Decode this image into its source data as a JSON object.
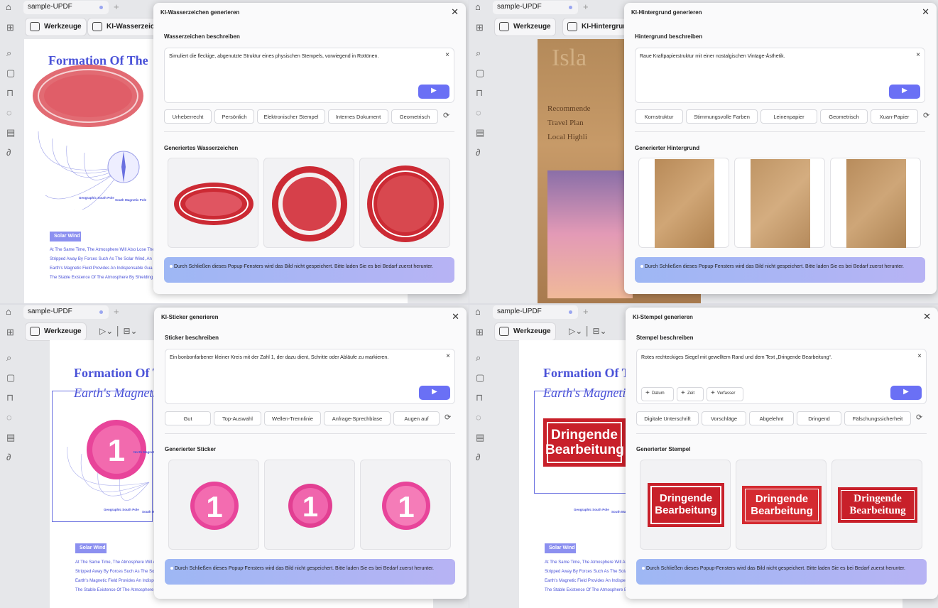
{
  "common": {
    "tab_name": "sample-UPDF",
    "tools": "Werkzeuge",
    "doc_title": "Formation Of The",
    "doc_subtitle": "Earth's Magnetic",
    "solar": "Solar Wind",
    "south_pole": "Geographic South Pole",
    "south_mag": "South Magnetic Pole",
    "north": "North Magnetic Pole",
    "lines": [
      "At The Same Time, The Atmosphere Will Also Lose The",
      "Stripped Away By Forces Such As The Solar Wind, An",
      "Earth's Magnetic Field Provides An Indispensable Gua",
      "The Stable Existence Of The Atmosphere By Shielding"
    ],
    "note": "Durch Schließen dieses Popup-Fensters wird das Bild nicht gespeichert. Bitte laden Sie es bei Bedarf zuerst herunter."
  },
  "watermark": {
    "tool": "KI-Wasserzeichen",
    "title": "KI-Wasserzeichen generieren",
    "describe": "Wasserzeichen beschreiben",
    "prompt": "Simuliert die fleckige, abgenutzte Struktur eines physischen Stempels, vorwiegend in Rottönen.",
    "chips": [
      "Urheberrecht",
      "Persönlich",
      "Elektronischer Stempel",
      "Internes Dokument",
      "Geometrisch"
    ],
    "result": "Generiertes Wasserzeichen"
  },
  "background": {
    "tool": "KI-Hintergrund",
    "title": "KI-Hintergrund generieren",
    "describe": "Hintergrund beschreiben",
    "prompt": "Raue Kraftpapierstruktur mit einer nostalgischen Vintage-Ästhetik.",
    "chips": [
      "Kornstruktur",
      "Stimmungsvolle Farben",
      "Leinenpapier",
      "Geometrisch",
      "Xuan-Papier"
    ],
    "result": "Generierter Hintergrund",
    "doc_lines": [
      "Isla",
      "Recommende",
      "Travel Plan",
      "Local Highli"
    ]
  },
  "sticker": {
    "title": "KI-Sticker generieren",
    "describe": "Sticker beschreiben",
    "prompt": "Ein bonbonfarbener kleiner Kreis mit der Zahl 1, der dazu dient, Schritte oder Abläufe zu markieren.",
    "chips": [
      "Gut",
      "Top-Auswahl",
      "Wellen-Trennlinie",
      "Anfrage-Sprechblase",
      "Augen auf"
    ],
    "result": "Generierter Sticker",
    "sticker_text": "1"
  },
  "stamp": {
    "title": "KI-Stempel generieren",
    "describe": "Stempel beschreiben",
    "prompt": "Rotes rechteckiges Siegel mit gewelltem Rand und dem Text „Dringende Bearbeitung“.",
    "mini": [
      "Datum",
      "Zeit",
      "Verfasser"
    ],
    "chips": [
      "Digitale Unterschrift",
      "Vorschläge",
      "Abgelehnt",
      "Dringend",
      "Fälschungssicherheit"
    ],
    "result": "Generierter Stempel",
    "stamp_line1": "Dringende",
    "stamp_line2": "Bearbeitung"
  },
  "colors": {
    "accent": "#6a70f5",
    "stamp_red": "#c8202a",
    "sticker_pink": "#e8449a",
    "kraft": "#c49a66"
  }
}
